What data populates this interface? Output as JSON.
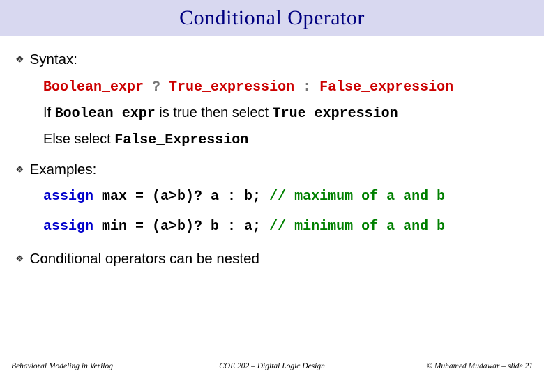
{
  "title": "Conditional Operator",
  "bullets": {
    "syntax": "Syntax:",
    "examples": "Examples:",
    "nested": "Conditional operators can be nested"
  },
  "syntax_line": {
    "be": "Boolean_expr",
    "q": " ? ",
    "te": "True_expression",
    "c": " : ",
    "fe": "False_expression"
  },
  "desc": {
    "if": "If ",
    "be": "Boolean_expr",
    "mid1": " is true then select ",
    "te": "True_expression",
    "else": "Else select ",
    "fe": "False_Expression"
  },
  "ex1": {
    "assign": "assign",
    "body": " max = (a>b)? a : b;  ",
    "cmt": "// maximum of a and b"
  },
  "ex2": {
    "assign": "assign",
    "body": " min = (a>b)? b : a;  ",
    "cmt": "// minimum of a and b"
  },
  "footer": {
    "left": "Behavioral Modeling in Verilog",
    "center": "COE 202 – Digital Logic Design",
    "right": "© Muhamed Mudawar – slide 21"
  }
}
